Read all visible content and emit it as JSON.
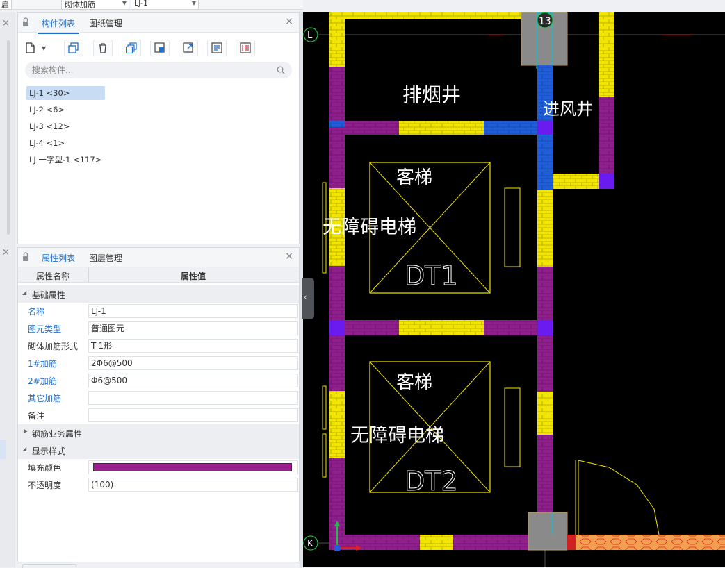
{
  "topbar": {
    "selectors": [
      {
        "label": "启",
        "has_arrow": false
      },
      {
        "label": "砌体加筋",
        "has_arrow": true
      },
      {
        "label": "LJ-1",
        "has_arrow": true
      }
    ]
  },
  "component_panel": {
    "tabs": [
      {
        "label": "构件列表",
        "active": true
      },
      {
        "label": "图纸管理",
        "active": false
      }
    ],
    "close": "×",
    "search_placeholder": "搜索构件...",
    "items": [
      {
        "label": "LJ-1 <30>",
        "selected": true
      },
      {
        "label": "LJ-2 <6>",
        "selected": false
      },
      {
        "label": "LJ-3 <12>",
        "selected": false
      },
      {
        "label": "LJ-4 <1>",
        "selected": false
      },
      {
        "label": "LJ 一字型-1 <117>",
        "selected": false
      }
    ]
  },
  "property_panel": {
    "tabs": [
      {
        "label": "属性列表",
        "active": true
      },
      {
        "label": "图层管理",
        "active": false
      }
    ],
    "close": "×",
    "col_name": "属性名称",
    "col_value": "属性值",
    "group_basic": "基础属性",
    "rows": [
      {
        "name": "名称",
        "value": "LJ-1",
        "blue": true
      },
      {
        "name": "图元类型",
        "value": "普通图元",
        "blue": true
      },
      {
        "name": "砌体加筋形式",
        "value": "T-1形",
        "blue": false
      },
      {
        "name": "1#加筋",
        "value": "2Φ6@500",
        "blue": true
      },
      {
        "name": "2#加筋",
        "value": "Φ6@500",
        "blue": true
      },
      {
        "name": "其它加筋",
        "value": "",
        "blue": true
      },
      {
        "name": "备注",
        "value": "",
        "blue": false
      }
    ],
    "group_rebar": "钢筋业务属性",
    "group_display": "显示样式",
    "fill_color_label": "填充颜色",
    "fill_color": "#9b1f8f",
    "opacity_label": "不透明度",
    "opacity_value": "(100)"
  },
  "cad": {
    "axis_labels": {
      "L": "L",
      "K": "K",
      "col13": "13"
    },
    "room_texts": {
      "smoke_shaft": "排烟井",
      "air_shaft": "进风井",
      "elevator1_name": "客梯",
      "elevator1_code": "DT1",
      "elevator2_name": "客梯",
      "elevator2_code": "DT2",
      "accessible1": "无障碍电梯",
      "accessible2": "无障碍电梯"
    },
    "colors": {
      "yellow": "#f2e600",
      "purple": "#8e1f8c",
      "blue": "#1f5ed8",
      "gray": "#8a8a8a",
      "orange": "#f0a050",
      "cyan": "#00c8d8"
    }
  }
}
